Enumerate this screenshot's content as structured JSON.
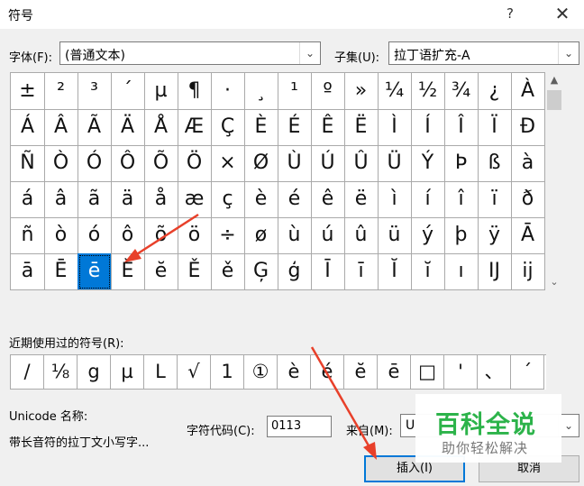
{
  "window": {
    "title": "符号",
    "help_label": "?",
    "close_label": "✕"
  },
  "font": {
    "label": "字体(F):",
    "value": "(普通文本)"
  },
  "subset": {
    "label": "子集(U):",
    "value": "拉丁语扩充-A"
  },
  "symbol_grid": {
    "rows": [
      [
        "±",
        "²",
        "³",
        "´",
        "µ",
        "¶",
        "·",
        "¸",
        "¹",
        "º",
        "»",
        "¼",
        "½",
        "¾",
        "¿",
        "À"
      ],
      [
        "Á",
        "Â",
        "Ã",
        "Ä",
        "Å",
        "Æ",
        "Ç",
        "È",
        "É",
        "Ê",
        "Ë",
        "Ì",
        "Í",
        "Î",
        "Ï",
        "Ð"
      ],
      [
        "Ñ",
        "Ò",
        "Ó",
        "Ô",
        "Õ",
        "Ö",
        "×",
        "Ø",
        "Ù",
        "Ú",
        "Û",
        "Ü",
        "Ý",
        "Þ",
        "ß",
        "à"
      ],
      [
        "á",
        "â",
        "ã",
        "ä",
        "å",
        "æ",
        "ç",
        "è",
        "é",
        "ê",
        "ë",
        "ì",
        "í",
        "î",
        "ï",
        "ð"
      ],
      [
        "ñ",
        "ò",
        "ó",
        "ô",
        "õ",
        "ö",
        "÷",
        "ø",
        "ù",
        "ú",
        "û",
        "ü",
        "ý",
        "þ",
        "ÿ",
        "Ā"
      ],
      [
        "ā",
        "Ē",
        "ē",
        "Ĕ",
        "ĕ",
        "Ě",
        "ě",
        "Ģ",
        "ģ",
        "Ī",
        "ī",
        "Ĭ",
        "ĭ",
        "ı",
        "Ĳ",
        "ĳ"
      ]
    ],
    "selected": {
      "row": 5,
      "col": 2
    }
  },
  "recent": {
    "label": "近期使用过的符号(R):",
    "symbols": [
      "/",
      "⅛",
      "g",
      "µ",
      "L",
      "√",
      "1",
      "①",
      "è",
      "é",
      "ĕ",
      "ē",
      "□",
      "'",
      "、",
      "´"
    ]
  },
  "unicode_name": {
    "label": "Unicode 名称:",
    "value": "带长音符的拉丁文小写字..."
  },
  "char_code": {
    "label": "字符代码(C):",
    "value": "0113"
  },
  "from": {
    "label": "来自(M):",
    "value": "U"
  },
  "buttons": {
    "insert": "插入(I)",
    "cancel": "取消"
  },
  "watermark": {
    "title": "百科全说",
    "subtitle": "助你轻松解决"
  },
  "colors": {
    "selected_bg": "#0078d7",
    "annotation_arrow": "#e8402a",
    "watermark_green": "#2cb34a"
  }
}
